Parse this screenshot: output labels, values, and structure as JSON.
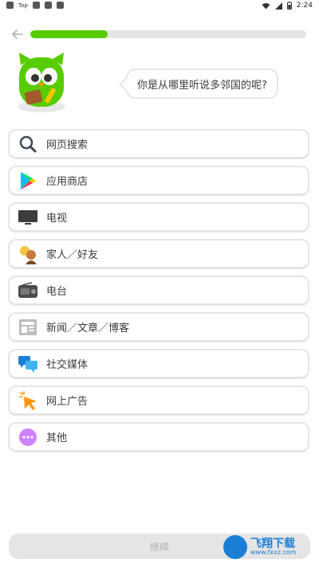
{
  "status_bar": {
    "time": "2:24",
    "left_text": "Top"
  },
  "progress": {
    "fraction": 0.28
  },
  "question": "你是从哪里听说多邻国的呢?",
  "options": [
    {
      "label": "网页搜索",
      "icon": "search-icon"
    },
    {
      "label": "应用商店",
      "icon": "play-store-icon"
    },
    {
      "label": "电视",
      "icon": "tv-icon"
    },
    {
      "label": "家人／好友",
      "icon": "family-icon"
    },
    {
      "label": "电台",
      "icon": "radio-icon"
    },
    {
      "label": "新闻／文章／博客",
      "icon": "newspaper-icon"
    },
    {
      "label": "社交媒体",
      "icon": "chat-bubbles-icon"
    },
    {
      "label": "网上广告",
      "icon": "cursor-click-icon"
    },
    {
      "label": "其他",
      "icon": "more-icon"
    }
  ],
  "continue_label": "继续",
  "watermark": {
    "line1": "飞翔下载",
    "line2": "www.fxxz.com"
  }
}
